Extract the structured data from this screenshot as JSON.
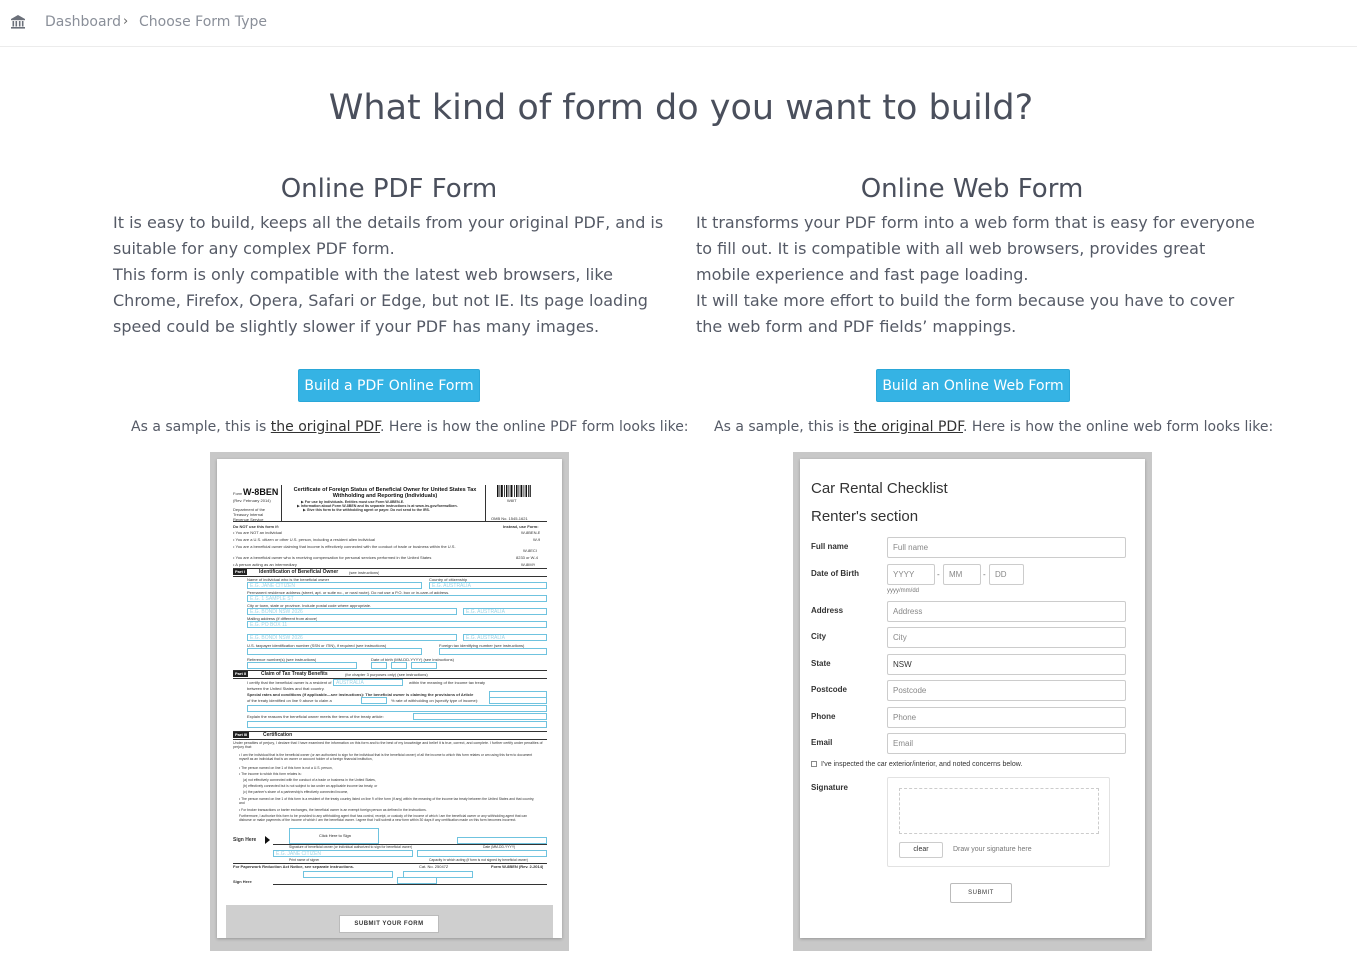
{
  "breadcrumb": {
    "home_icon": "bank-icon",
    "dashboard": "Dashboard",
    "separator": "›",
    "current": "Choose Form Type"
  },
  "page_title": "What kind of form do you want to build?",
  "left": {
    "heading": "Online PDF Form",
    "paragraph1": "It is easy to build, keeps all the details from your original PDF, and is suitable for any complex PDF form.",
    "paragraph2": "This form is only compatible with the latest web browsers, like Chrome, Firefox, Opera, Safari or Edge, but not IE. Its page loading speed could be slightly slower if your PDF has many images.",
    "button": "Build a PDF Online Form",
    "sample_prefix": "As a sample, this is ",
    "sample_link": "the original PDF",
    "sample_suffix": ". Here is how the online PDF form looks like:"
  },
  "right": {
    "heading": "Online Web Form",
    "paragraph1": "It transforms your PDF form into a web form that is easy for everyone to fill out. It is compatible with all web browsers, provides great mobile experience and fast page loading.",
    "paragraph2": "It will take more effort to build the form because you have to cover the web form and PDF fields’ mappings.",
    "button": "Build an Online Web Form",
    "sample_prefix": "As a sample, this is ",
    "sample_link": "the original PDF",
    "sample_suffix": ". Here is how the online web form looks like:"
  },
  "pdf_preview": {
    "form_label": "Form",
    "form_id": "W-8BEN",
    "rev": "(Rev. February 2014)",
    "dept": "Department of the Treasury Internal Revenue Service",
    "title": "Certificate of Foreign Status of Beneficial Owner for United States Tax Withholding and Reporting (Individuals)",
    "instr1": "▶ For use by individuals. Entities must use Form W-8BEN-E.",
    "instr2": "▶ Information about Form W-8BEN and its separate instructions is at www.irs.gov/formw8ben.",
    "instr3": "▶ Give this form to the withholding agent or payer. Do not send to the IRS.",
    "omb": "OMB No. 1545-1621",
    "barcode_label": "W8IT",
    "do_not_use": "Do NOT use this form if:",
    "instead": "Instead, use Form:",
    "lines": [
      "• You are NOT an individual",
      "• You are a U.S. citizen or other U.S. person, including a resident alien individual",
      "• You are a beneficial owner claiming that income is effectively connected with the conduct of trade or business within the U.S.",
      "• You are a beneficial owner who is receiving compensation for personal services performed in the United States",
      "• A person acting as an intermediary"
    ],
    "alt_forms": [
      "W-8BEN-E",
      "W-9",
      "W-8ECI",
      "8233 or W-4",
      "W-8IMY"
    ],
    "part1_tag": "Part I",
    "part1_title": "Identification of Beneficial Owner",
    "part1_sub": "(see instructions)",
    "field_name": "E.G. JANE CITIZEN",
    "field_country": "E.G. AUSTRALIA",
    "field_street": "E.G. 1 SAMPLE ST",
    "field_city": "E.G. BONDI NSW 2026",
    "field_mail": "E.G. PO BOX 11",
    "field_country2": "E.G. AUSTRALIA",
    "field_city2": "E.G. BONDI NSW 2026",
    "field_country3": "E.G. AUSTRALIA",
    "label_name": "Name of individual who is the beneficial owner",
    "label_country": "Country of citizenship",
    "label_street": "Permanent residence address (street, apt. or suite no., or rural route). Do not use a P.O. box or in-care-of address.",
    "label_city": "City or town, state or province. Include postal code where appropriate.",
    "label_mail": "Mailing address (if different from above)",
    "label_tin": "U.S. taxpayer identification number (SSN or ITIN), if required (see instructions)",
    "label_ftin": "Foreign tax identifying number (see instructions)",
    "label_ref": "Reference number(s) (see instructions)",
    "label_dob": "Date of birth (MM-DD-YYYY) (see instructions)",
    "part2_tag": "Part II",
    "part2_title": "Claim of Tax Treaty Benefits",
    "part2_sub": "(for chapter 3 purposes only) (see instructions)",
    "treaty_line": "I certify that the beneficial owner is a resident of",
    "treaty_field": "AUSTRALIA",
    "treaty_suffix": "within the meaning of the income tax treaty",
    "treaty_line2": "between the United States and that country.",
    "special_rates": "Special rates and conditions (if applicable—see instructions): The beneficial owner is claiming the provisions of Article",
    "special_rates2": "of the treaty identified on line 9 above to claim a",
    "special_rates3": "% rate of withholding on (specify type of income):",
    "explain": "Explain the reasons the beneficial owner meets the terms of the treaty article:",
    "part3_tag": "Part III",
    "part3_title": "Certification",
    "cert_text": "Under penalties of perjury, I declare that I have examined the information on this form and to the best of my knowledge and belief it is true, correct, and complete. I further certify under penalties of perjury that:",
    "cert_items": [
      "• I am the individual that is the beneficial owner (or am authorized to sign for the individual that is the beneficial owner) of all the income to which this form relates or am using this form to document myself as an individual that is an owner or account holder of a foreign financial institution,",
      "• The person named on line 1 of this form is not a U.S. person,",
      "• The income to which this form relates is:",
      "(a) not effectively connected with the conduct of a trade or business in the United States,",
      "(b) effectively connected but is not subject to tax under an applicable income tax treaty, or",
      "(c) the partner's share of a partnership's effectively connected income,",
      "• The person named on line 1 of this form is a resident of the treaty country listed on line 9 of the form (if any) within the meaning of the income tax treaty between the United States and that country, and",
      "• For broker transactions or barter exchanges, the beneficial owner is an exempt foreign person as defined in the instructions.",
      "Furthermore, I authorize this form to be provided to any withholding agent that has control, receipt, or custody of the income of which I am the beneficial owner or any withholding agent that can disburse or make payments of the income of which I am the beneficial owner. I agree that I will submit a new form within 30 days if any certification made on this form becomes incorrect."
    ],
    "click_sign": "Click Here to Sign",
    "sign_here": "Sign Here",
    "sig_label": "Signature of beneficial owner (or individual authorized to sign for beneficial owner)",
    "date_label": "Date (MM-DD-YYYY)",
    "print_name_field": "E.G. JANE CITIZEN",
    "print_name": "Print name of signer",
    "capacity": "Capacity in which acting (if form is not signed by beneficial owner)",
    "paperwork": "For Paperwork Reduction Act Notice, see separate instructions.",
    "cat_no": "Cat. No. 25047Z",
    "form_footer": "Form W-8BEN (Rev. 2-2014)",
    "sign_here2": "Sign Here",
    "submit": "SUBMIT YOUR FORM"
  },
  "web_preview": {
    "title": "Car Rental Checklist",
    "section": "Renter's section",
    "full_name_label": "Full name",
    "full_name_placeholder": "Full name",
    "dob_label": "Date of Birth",
    "dob_yyyy": "YYYY",
    "dob_mm": "MM",
    "dob_dd": "DD",
    "dob_sep": "-",
    "dob_hint": "yyyy/mm/dd",
    "address_label": "Address",
    "address_placeholder": "Address",
    "city_label": "City",
    "city_placeholder": "City",
    "state_label": "State",
    "state_value": "NSW",
    "postcode_label": "Postcode",
    "postcode_placeholder": "Postcode",
    "phone_label": "Phone",
    "phone_placeholder": "Phone",
    "email_label": "Email",
    "email_placeholder": "Email",
    "inspect_check": "I've inspected the car exterior/interior, and noted concerns below.",
    "signature_label": "Signature",
    "clear": "clear",
    "sig_hint": "Draw your signature here",
    "submit": "SUBMIT"
  },
  "colors": {
    "button": "#35b3e4",
    "text": "#4a4f5c",
    "frame": "#c8c8c8",
    "field_outline": "#6fc3df"
  }
}
